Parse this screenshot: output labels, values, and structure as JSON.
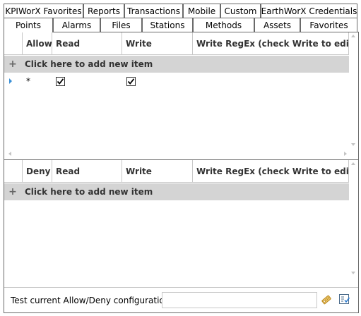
{
  "tabs_row1": [
    {
      "label": "KPIWorX Favorites"
    },
    {
      "label": "Reports"
    },
    {
      "label": "Transactions"
    },
    {
      "label": "Mobile"
    },
    {
      "label": "Custom"
    },
    {
      "label": "EarthWorX Credentials"
    }
  ],
  "tabs_row2": [
    {
      "label": "Points",
      "active": true
    },
    {
      "label": "Alarms"
    },
    {
      "label": "Files"
    },
    {
      "label": "Stations"
    },
    {
      "label": "Methods"
    },
    {
      "label": "Assets"
    },
    {
      "label": "Favorites"
    }
  ],
  "allow_grid": {
    "columns": [
      "Allow",
      "Read",
      "Write",
      "Write RegEx (check Write to edit)"
    ],
    "new_item": "Click here to add new item",
    "rows": [
      {
        "value": "*",
        "read": true,
        "write": true
      }
    ]
  },
  "deny_grid": {
    "columns": [
      "Deny",
      "Read",
      "Write",
      "Write RegEx (check Write to edit)"
    ],
    "new_item": "Click here to add new item",
    "rows": []
  },
  "footer": {
    "label": "Test current Allow/Deny configuration:",
    "input_value": "",
    "icons": [
      "tag-icon",
      "test-rules-icon"
    ]
  },
  "colors": {
    "new_row_bg": "#d4d4d4",
    "row_indicator": "#3a8fd6",
    "border": "#6a6a6a"
  }
}
